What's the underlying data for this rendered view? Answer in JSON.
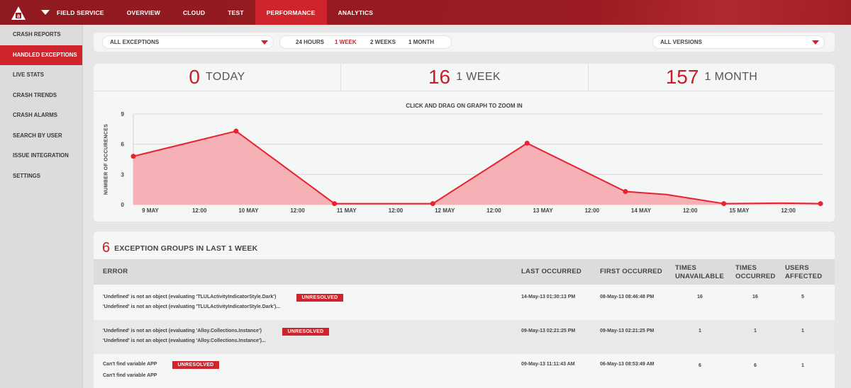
{
  "topbar": {
    "nav": [
      {
        "label": "FIELD SERVICE",
        "active": false
      },
      {
        "label": "OVERVIEW",
        "active": false
      },
      {
        "label": "CLOUD",
        "active": false
      },
      {
        "label": "TEST",
        "active": false
      },
      {
        "label": "PERFORMANCE",
        "active": true
      },
      {
        "label": "ANALYTICS",
        "active": false
      }
    ]
  },
  "sidebar": {
    "items": [
      {
        "label": "CRASH REPORTS",
        "active": false
      },
      {
        "label": "HANDLED EXCEPTIONS",
        "active": true
      },
      {
        "label": "LIVE STATS",
        "active": false
      },
      {
        "label": "CRASH TRENDS",
        "active": false
      },
      {
        "label": "CRASH ALARMS",
        "active": false
      },
      {
        "label": "SEARCH BY USER",
        "active": false
      },
      {
        "label": "ISSUE INTEGRATION",
        "active": false
      },
      {
        "label": "SETTINGS",
        "active": false
      }
    ]
  },
  "filters": {
    "exceptions_select": "ALL EXCEPTIONS",
    "ranges": [
      {
        "label": "24 HOURS",
        "active": false
      },
      {
        "label": "1 WEEK",
        "active": true
      },
      {
        "label": "2 WEEKS",
        "active": false
      },
      {
        "label": "1 MONTH",
        "active": false
      }
    ],
    "versions_select": "ALL VERSIONS"
  },
  "stats": {
    "today": {
      "value": "0",
      "label": "TODAY"
    },
    "week": {
      "value": "16",
      "label": "1 WEEK"
    },
    "month": {
      "value": "157",
      "label": "1 MONTH"
    }
  },
  "chart": {
    "hint": "CLICK AND DRAG ON GRAPH TO ZOOM IN",
    "ylabel": "NUMBER OF OCCURENCES"
  },
  "chart_data": {
    "type": "area",
    "ylabel": "NUMBER OF OCCURENCES",
    "ylim": [
      0,
      9
    ],
    "yticks": [
      0,
      3,
      6,
      9
    ],
    "xticks": [
      "9 MAY",
      "12:00",
      "10 MAY",
      "12:00",
      "11 MAY",
      "12:00",
      "12 MAY",
      "12:00",
      "13 MAY",
      "12:00",
      "14 MAY",
      "12:00",
      "15 MAY",
      "12:00"
    ],
    "x_range": [
      "2013-05-09 00:00",
      "2013-05-15 20:00"
    ],
    "points": [
      {
        "x": "2013-05-08 20:00",
        "y": 4.8
      },
      {
        "x": "2013-05-09 23:00",
        "y": 7.3
      },
      {
        "x": "2013-05-10 23:00",
        "y": 0.1
      },
      {
        "x": "2013-05-11 23:00",
        "y": 0.1
      },
      {
        "x": "2013-05-12 22:00",
        "y": 6.1
      },
      {
        "x": "2013-05-13 22:00",
        "y": 1.3
      },
      {
        "x": "2013-05-14 22:00",
        "y": 0.1
      },
      {
        "x": "2013-05-15 22:00",
        "y": 0.1
      }
    ],
    "intermediate": [
      {
        "x": "2013-05-14 08:00",
        "y": 1.0
      },
      {
        "x": "2013-05-15 12:00",
        "y": 0.15
      }
    ],
    "color": "#e8222e",
    "fill": "#f6aab0",
    "grid": true
  },
  "exceptions": {
    "count": "6",
    "title": "EXCEPTION GROUPS IN LAST 1 WEEK",
    "headers": {
      "error": "ERROR",
      "last": "LAST OCCURRED",
      "first": "FIRST OCCURRED",
      "unavailable": [
        "TIMES",
        "UNAVAILABLE"
      ],
      "occurred": [
        "TIMES",
        "OCCURRED"
      ],
      "users": [
        "USERS",
        "AFFECTED"
      ]
    },
    "rows": [
      {
        "title": "'Undefined' is not an object (evaluating 'TLULActivityIndicatorStyle.Dark')",
        "detail": "'Undefined' is not an object (evaluating 'TLULActivityIndicatorStyle.Dark')...",
        "status": "UNRESOLVED",
        "last": "14-May-13 01:30:13 PM",
        "first": "08-May-13 08:46:48 PM",
        "unavailable": "16",
        "occurred": "16",
        "users": "5"
      },
      {
        "title": "'Undefined' is not an object (evaluating 'Alloy.Collections.Instance')",
        "detail": "'Undefined' is not an object (evaluating 'Alloy.Collections.Instance')...",
        "status": "UNRESOLVED",
        "last": "09-May-13 02:21:25 PM",
        "first": "09-May-13 02:21:25 PM",
        "unavailable": "1",
        "occurred": "1",
        "users": "1"
      },
      {
        "title": "Can't find variable APP",
        "detail": "Can't find variable APP",
        "status": "UNRESOLVED",
        "last": "09-May-13 11:11:43 AM",
        "first": "06-May-13 08:53:49 AM",
        "unavailable": "6",
        "occurred": "6",
        "users": "1"
      }
    ]
  }
}
